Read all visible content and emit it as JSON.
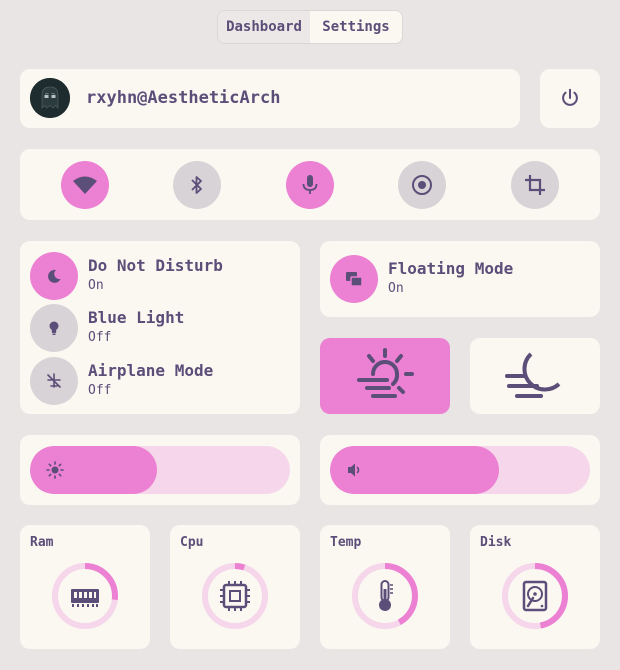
{
  "tabs": [
    {
      "label": "Dashboard",
      "active": false
    },
    {
      "label": "Settings",
      "active": true
    }
  ],
  "user": {
    "name": "rxyhn@AestheticArch",
    "avatar_icon": "ghost-avatar-icon"
  },
  "power": {
    "icon": "power-icon"
  },
  "quick_toggles": [
    {
      "name": "wifi",
      "icon": "wifi-icon",
      "active": true
    },
    {
      "name": "bluetooth",
      "icon": "bluetooth-icon",
      "active": false
    },
    {
      "name": "microphone",
      "icon": "microphone-icon",
      "active": true
    },
    {
      "name": "screen-record",
      "icon": "record-icon",
      "active": false
    },
    {
      "name": "screenshot",
      "icon": "crop-icon",
      "active": false
    }
  ],
  "settings": [
    {
      "title": "Do Not Disturb",
      "state": "On",
      "icon": "moon-icon",
      "active": true
    },
    {
      "title": "Blue Light",
      "state": "Off",
      "icon": "lightbulb-icon",
      "active": false
    },
    {
      "title": "Airplane Mode",
      "state": "Off",
      "icon": "airplane-off-icon",
      "active": false
    }
  ],
  "floating_mode": {
    "title": "Floating Mode",
    "state": "On",
    "icon": "floating-windows-icon",
    "active": true
  },
  "theme": {
    "light_icon": "sun-haze-icon",
    "dark_icon": "moon-haze-icon",
    "selected": "light"
  },
  "sliders": {
    "brightness": {
      "icon": "brightness-icon",
      "value": 0.49
    },
    "volume": {
      "icon": "volume-icon",
      "value": 0.65
    }
  },
  "stats": [
    {
      "label": "Ram",
      "icon": "memory-icon",
      "value": 0.27
    },
    {
      "label": "Cpu",
      "icon": "cpu-icon",
      "value": 0.05
    },
    {
      "label": "Temp",
      "icon": "thermometer-icon",
      "value": 0.42
    },
    {
      "label": "Disk",
      "icon": "harddisk-icon",
      "value": 0.47
    }
  ],
  "colors": {
    "background": "#e9e5e5",
    "card": "#fbf8f2",
    "accent": "#ec80d2",
    "accent_light": "#f5d6ea",
    "inactive": "#d8d3d6",
    "text": "#5b4e78"
  }
}
